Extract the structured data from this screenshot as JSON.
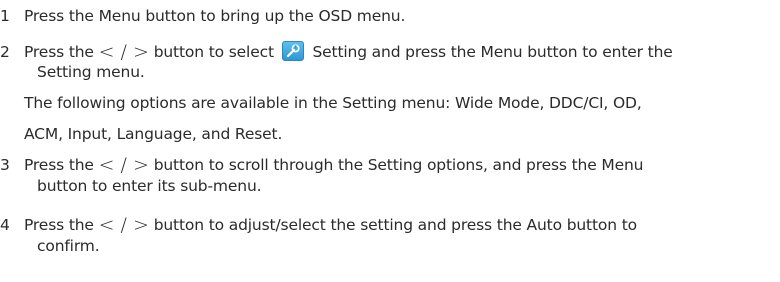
{
  "steps": [
    {
      "number": "1",
      "text": "Press the Menu button to bring up the OSD menu."
    },
    {
      "number": "2",
      "pre": "Press the ",
      "arrows": "< / >",
      "mid": " button to select ",
      "icon": "setting-wrench-gear-icon",
      "post": " Setting and press the Menu button to enter the",
      "cont": "Setting menu."
    },
    {
      "note_line1": "The following options are available in the Setting menu: Wide Mode, DDC/CI, OD,",
      "note_line2": "ACM, Input, Language, and Reset."
    },
    {
      "number": "3",
      "pre": "Press the ",
      "arrows": "< / >",
      "post": " button to scroll through the Setting options, and press the Menu",
      "cont": "button to enter its sub-menu."
    },
    {
      "number": "4",
      "pre": "Press the ",
      "arrows": "< / >",
      "post": " button to adjust/select the setting and press the Auto button to",
      "cont": "confirm."
    }
  ],
  "colors": {
    "text": "#2b2b2b",
    "icon_bg": "#3ca9e0"
  }
}
